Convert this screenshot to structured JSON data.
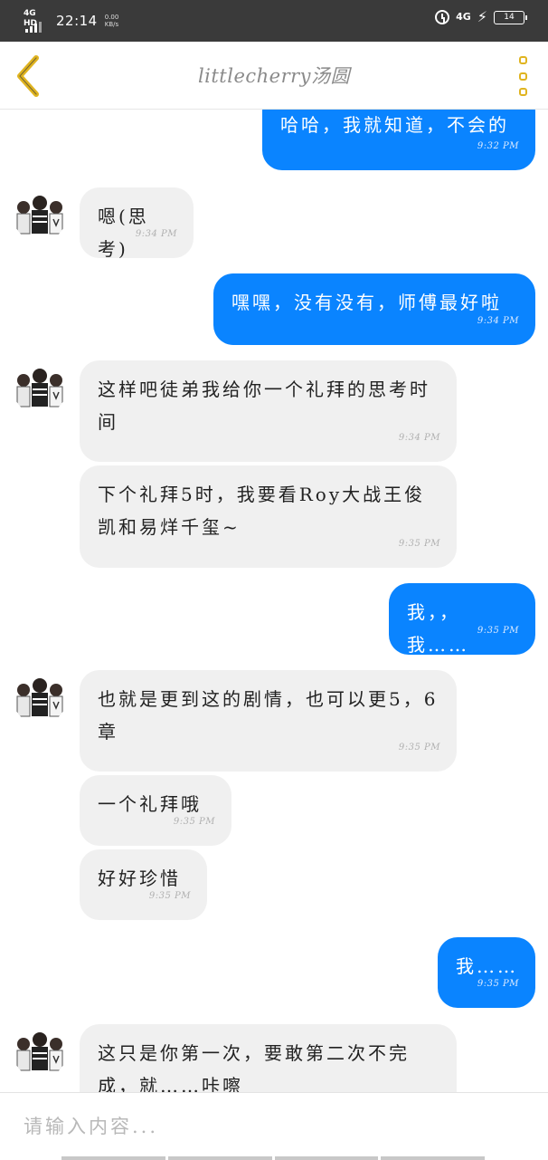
{
  "status_bar": {
    "network_type": "4G HD",
    "time": "22:14",
    "speed_value": "0.00",
    "speed_unit": "KB/s",
    "signal_right": "4G",
    "battery": "14"
  },
  "header": {
    "title": "littlecherry汤圆",
    "back_icon": "chevron-left-icon",
    "menu_icon": "more-vertical-icon",
    "accent_color": "#e0b420"
  },
  "messages": [
    {
      "side": "out",
      "text": "哈哈，我就知道，不会的",
      "time": "9:32 PM"
    },
    {
      "side": "in",
      "text": "嗯(思考)",
      "time": "9:34 PM"
    },
    {
      "side": "out",
      "text": "嘿嘿，没有没有，师傅最好啦",
      "time": "9:34 PM"
    },
    {
      "side": "in",
      "text": "这样吧徒弟我给你一个礼拜的思考时间",
      "time": "9:34 PM"
    },
    {
      "side": "in",
      "text": "下个礼拜5时，我要看Roy大战王俊凯和易烊千玺~",
      "time": "9:35 PM"
    },
    {
      "side": "out",
      "text": "我，，我……",
      "time": "9:35 PM"
    },
    {
      "side": "in",
      "text": "也就是更到这的剧情，也可以更5，6章",
      "time": "9:35 PM"
    },
    {
      "side": "in",
      "text": "一个礼拜哦",
      "time": "9:35 PM"
    },
    {
      "side": "in",
      "text": "好好珍惜",
      "time": "9:35 PM"
    },
    {
      "side": "out",
      "text": "我……",
      "time": "9:35 PM"
    },
    {
      "side": "in",
      "text": "这只是你第一次，要敢第二次不完成，就……咔嚓",
      "time": ""
    }
  ],
  "input": {
    "placeholder": "请输入内容..."
  },
  "colors": {
    "outgoing_bubble": "#0a84ff",
    "incoming_bubble": "#f0f0f0",
    "status_bar": "#3a3a3a"
  }
}
